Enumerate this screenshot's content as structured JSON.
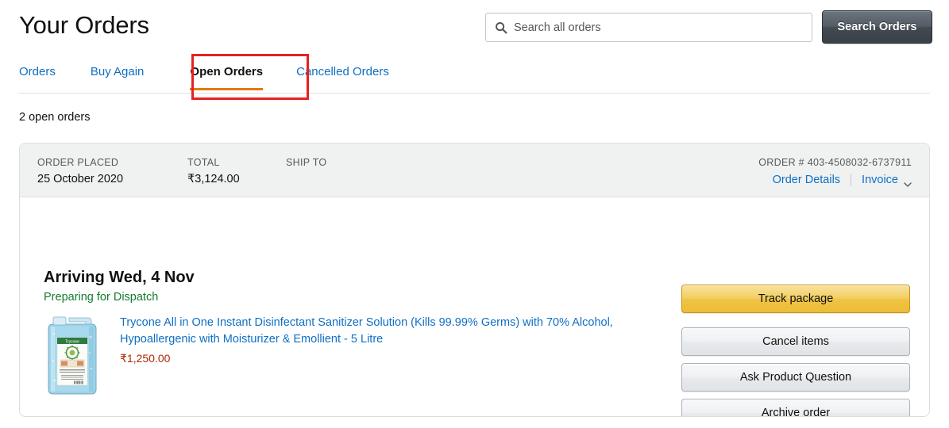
{
  "header": {
    "title": "Your Orders",
    "search": {
      "placeholder": "Search all orders",
      "value": "",
      "icon": "search-icon"
    },
    "search_button_label": "Search Orders"
  },
  "tabs": [
    {
      "label": "Orders",
      "active": false
    },
    {
      "label": "Buy Again",
      "active": false
    },
    {
      "label": "Open Orders",
      "active": true
    },
    {
      "label": "Cancelled Orders",
      "active": false
    }
  ],
  "highlight": {
    "target_tab": "Open Orders",
    "color": "#E82020"
  },
  "orders_count_label": "2 open orders",
  "order": {
    "header": {
      "order_placed_label": "ORDER PLACED",
      "order_placed_value": "25 October 2020",
      "total_label": "TOTAL",
      "total_value": "₹3,124.00",
      "ship_to_label": "SHIP TO",
      "ship_to_value": "",
      "order_number_label": "ORDER # 403-4508032-6737911",
      "order_details_link": "Order Details",
      "invoice_link": "Invoice",
      "invoice_chevron": "chevron-down-icon"
    },
    "delivery": {
      "arriving": "Arriving Wed, 4 Nov",
      "status": "Preparing for Dispatch",
      "status_color": "#147A2F"
    },
    "item": {
      "title": "Trycone All in One Instant Disinfectant Sanitizer Solution (Kills 99.99% Germs) with 70% Alcohol, Hypoallergenic with Moisturizer & Emollient - 5 Litre",
      "price": "₹1,250.00",
      "image_alt": "product-thumbnail-sanitizer-jerrycan",
      "brand_on_label": "Trycone"
    },
    "actions": [
      {
        "label": "Track package",
        "style": "primary"
      },
      {
        "label": "Cancel items",
        "style": "secondary"
      },
      {
        "label": "Ask Product Question",
        "style": "secondary"
      },
      {
        "label": "Archive order",
        "style": "secondary"
      }
    ]
  },
  "colors": {
    "link": "#0F6FC4",
    "accent_orange": "#E47911",
    "price": "#B12704",
    "header_bg": "#F0F2F2",
    "primary_button": "#F0C14B"
  }
}
